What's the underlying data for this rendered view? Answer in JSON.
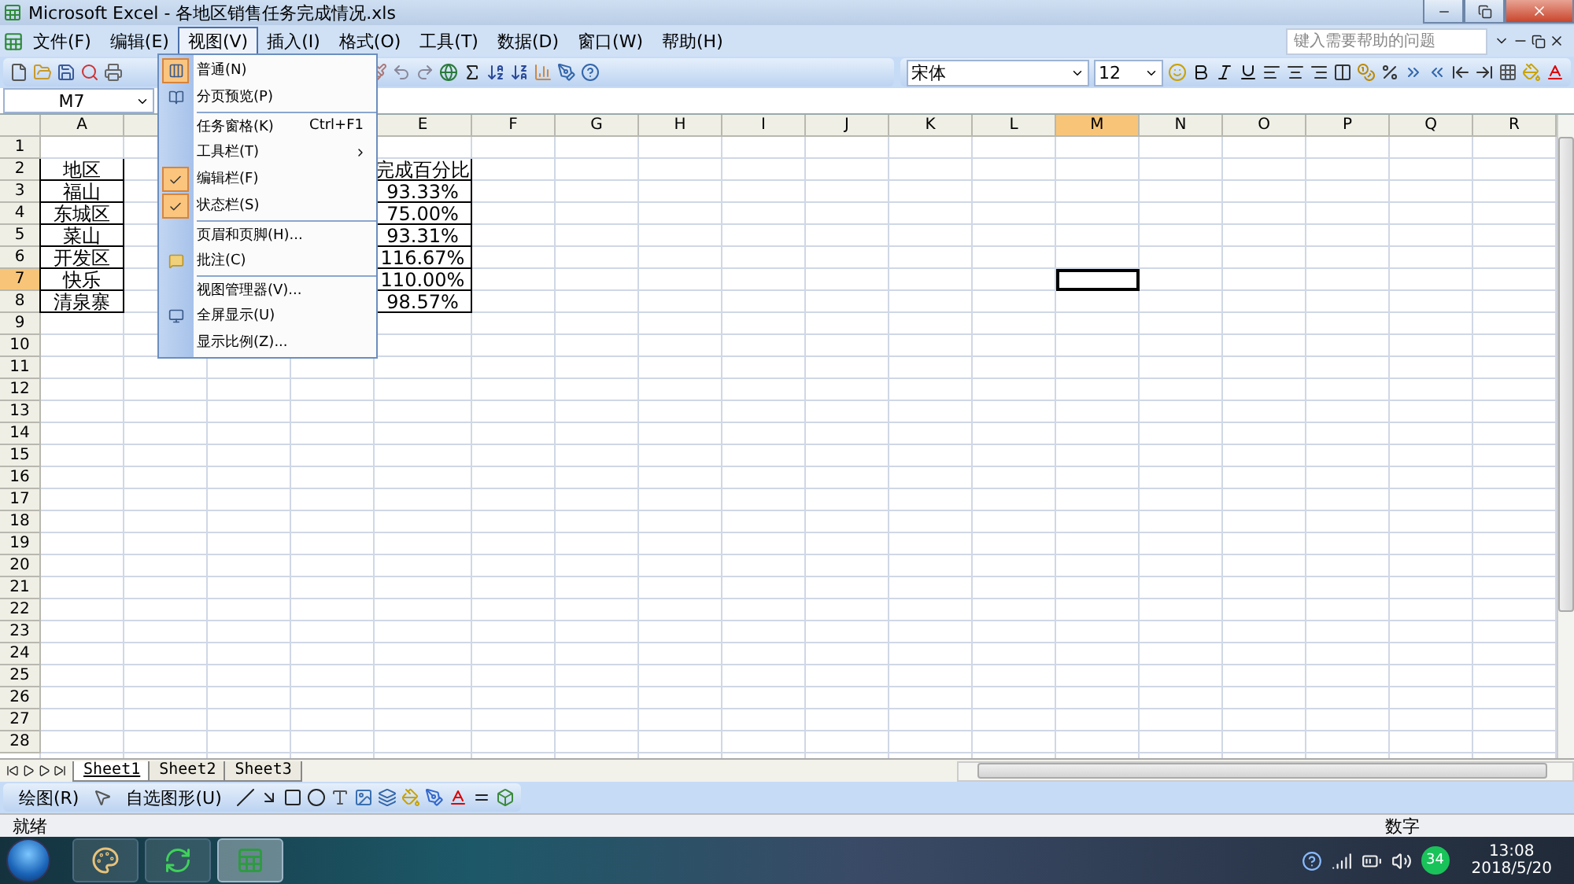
{
  "window": {
    "title": "Microsoft Excel - 各地区销售任务完成情况.xls"
  },
  "menu_bar": [
    {
      "label": "文件(F)",
      "selected": false
    },
    {
      "label": "编辑(E)",
      "selected": false
    },
    {
      "label": "视图(V)",
      "selected": true
    },
    {
      "label": "插入(I)",
      "selected": false
    },
    {
      "label": "格式(O)",
      "selected": false
    },
    {
      "label": "工具(T)",
      "selected": false
    },
    {
      "label": "数据(D)",
      "selected": false
    },
    {
      "label": "窗口(W)",
      "selected": false
    },
    {
      "label": "帮助(H)",
      "selected": false
    }
  ],
  "help_search": {
    "placeholder": "键入需要帮助的问题"
  },
  "formatting": {
    "font": "宋体",
    "size": "12"
  },
  "name_box": "M7",
  "columns": [
    {
      "label": "A",
      "selected": false
    },
    {
      "label": "E",
      "selected": false
    },
    {
      "label": "F",
      "selected": false
    },
    {
      "label": "G",
      "selected": false
    },
    {
      "label": "H",
      "selected": false
    },
    {
      "label": "I",
      "selected": false
    },
    {
      "label": "J",
      "selected": false
    },
    {
      "label": "K",
      "selected": false
    },
    {
      "label": "L",
      "selected": false
    },
    {
      "label": "M",
      "selected": true
    },
    {
      "label": "N",
      "selected": false
    },
    {
      "label": "O",
      "selected": false
    },
    {
      "label": "P",
      "selected": false
    },
    {
      "label": "Q",
      "selected": false
    },
    {
      "label": "R",
      "selected": false
    }
  ],
  "rows": [
    {
      "label": "1",
      "selected": false
    },
    {
      "label": "2",
      "selected": false,
      "a": "地区",
      "e": "完成百分比"
    },
    {
      "label": "3",
      "selected": false,
      "a": "福山",
      "e": "93.33%"
    },
    {
      "label": "4",
      "selected": false,
      "a": "东城区",
      "e": "75.00%"
    },
    {
      "label": "5",
      "selected": false,
      "a": "菜山",
      "e": "93.31%"
    },
    {
      "label": "6",
      "selected": false,
      "a": "开发区",
      "e": "116.67%"
    },
    {
      "label": "7",
      "selected": true,
      "a": "快乐",
      "e": "110.00%"
    },
    {
      "label": "8",
      "selected": false,
      "a": "清泉寨",
      "e": "98.57%"
    },
    {
      "label": "9",
      "selected": false
    },
    {
      "label": "10",
      "selected": false
    },
    {
      "label": "11",
      "selected": false
    },
    {
      "label": "12",
      "selected": false
    },
    {
      "label": "13",
      "selected": false
    },
    {
      "label": "14",
      "selected": false
    },
    {
      "label": "15",
      "selected": false
    },
    {
      "label": "16",
      "selected": false
    },
    {
      "label": "17",
      "selected": false
    },
    {
      "label": "18",
      "selected": false
    },
    {
      "label": "19",
      "selected": false
    },
    {
      "label": "20",
      "selected": false
    },
    {
      "label": "21",
      "selected": false
    },
    {
      "label": "22",
      "selected": false
    },
    {
      "label": "23",
      "selected": false
    },
    {
      "label": "24",
      "selected": false
    },
    {
      "label": "25",
      "selected": false
    },
    {
      "label": "26",
      "selected": false
    },
    {
      "label": "27",
      "selected": false
    },
    {
      "label": "28",
      "selected": false
    }
  ],
  "view_menu": [
    {
      "label": "普通(N)",
      "kind": "normal",
      "selected": true
    },
    {
      "label": "分页预览(P)",
      "kind": "pagebreak",
      "selected": false
    },
    {
      "label": "任务窗格(K)",
      "kind": "plain",
      "shortcut": "Ctrl+F1",
      "separator_before": true
    },
    {
      "label": "工具栏(T)",
      "kind": "submenu"
    },
    {
      "label": "编辑栏(F)",
      "kind": "check",
      "checked": true
    },
    {
      "label": "状态栏(S)",
      "kind": "check",
      "checked": true
    },
    {
      "label": "页眉和页脚(H)...",
      "kind": "plain",
      "separator_before": true
    },
    {
      "label": "批注(C)",
      "kind": "comment"
    },
    {
      "label": "视图管理器(V)...",
      "kind": "plain",
      "separator_before": true
    },
    {
      "label": "全屏显示(U)",
      "kind": "fullscreen"
    },
    {
      "label": "显示比例(Z)...",
      "kind": "plain"
    }
  ],
  "sheet_tabs": [
    {
      "label": "Sheet1",
      "selected": true
    },
    {
      "label": "Sheet2",
      "selected": false
    },
    {
      "label": "Sheet3",
      "selected": false
    }
  ],
  "drawing_toolbar": {
    "draw": "绘图(R)",
    "autoshapes": "自选图形(U)"
  },
  "status_bar": {
    "left": "就绪",
    "right": "数字"
  },
  "taskbar": {
    "apps": [
      {
        "kind": "paint",
        "selected": false
      },
      {
        "kind": "browser",
        "selected": false
      },
      {
        "kind": "excel",
        "selected": true
      }
    ],
    "badge": "34",
    "time": "13:08",
    "date": "2018/5/20"
  }
}
